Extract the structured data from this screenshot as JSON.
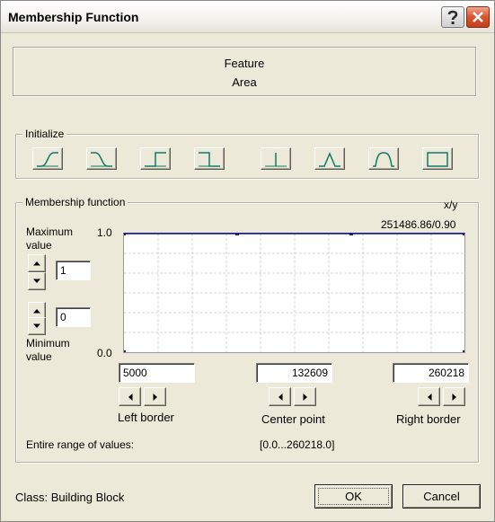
{
  "window": {
    "title": "Membership Function"
  },
  "feature": {
    "label": "Feature",
    "value": "Area"
  },
  "initialize": {
    "label": "Initialize",
    "shapes": [
      "s-curve-icon",
      "z-curve-icon",
      "step-up-icon",
      "step-down-icon",
      "singleton-icon",
      "triangle-icon",
      "bell-curve-icon",
      "rectangle-icon"
    ]
  },
  "membership": {
    "label": "Membership function",
    "xy_label": "x/y",
    "xy_readout": "251486.86/0.90",
    "max_label_line1": "Maximum",
    "max_label_line2": "value",
    "max_value": "1",
    "min_label_line1": "Minimum",
    "min_label_line2": "value",
    "min_value": "0",
    "y_top": "1.0",
    "y_bottom": "0.0",
    "left_border_value": "5000",
    "center_point_value": "132609",
    "right_border_value": "260218",
    "left_border_label": "Left border",
    "center_point_label": "Center point",
    "right_border_label": "Right border",
    "range_label": "Entire range of values:",
    "range_value": "[0.0...260218.0]"
  },
  "class_info": "Class: Building Block",
  "buttons": {
    "ok": "OK",
    "cancel": "Cancel"
  },
  "colors": {
    "curve": "#1c1c8c",
    "shape_icon": "#0e7a6a",
    "close": "#d9532d"
  }
}
